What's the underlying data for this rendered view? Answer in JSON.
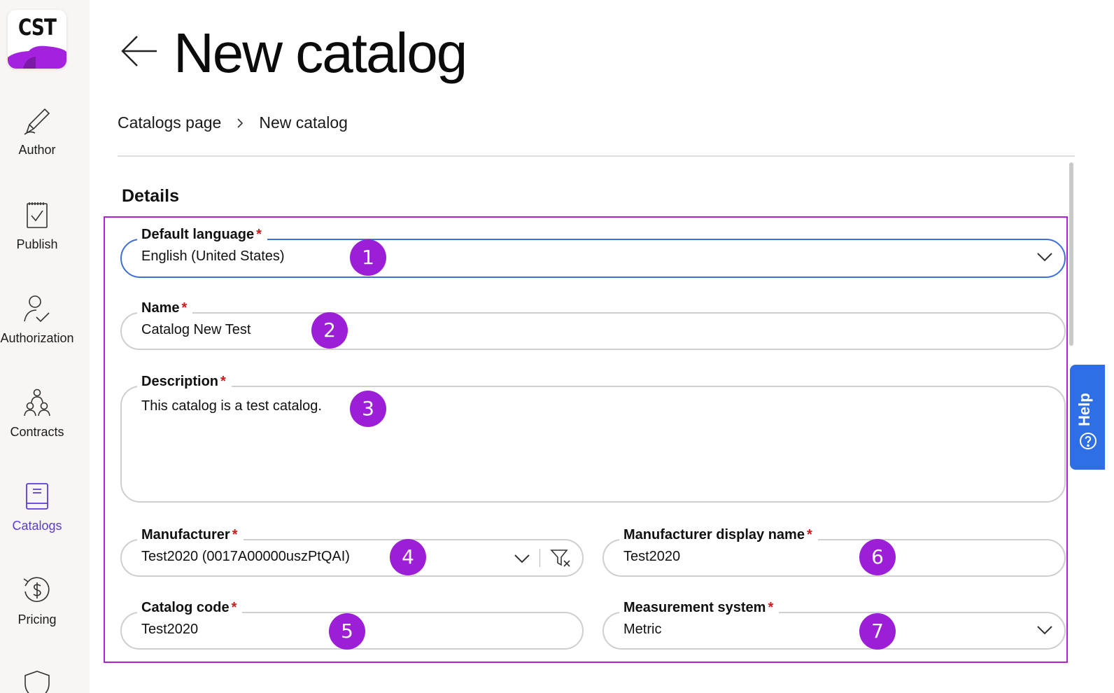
{
  "app": {
    "logo_text": "CST",
    "brand_color": "#a521e0"
  },
  "sidebar": {
    "items": [
      {
        "label": "Author",
        "icon": "pen-icon"
      },
      {
        "label": "Publish",
        "icon": "clipboard-check-icon"
      },
      {
        "label": "Authorization",
        "icon": "user-check-icon"
      },
      {
        "label": "Contracts",
        "icon": "people-group-icon"
      },
      {
        "label": "Catalogs",
        "icon": "book-icon",
        "active": true
      },
      {
        "label": "Pricing",
        "icon": "dollar-refresh-icon"
      }
    ],
    "active_color": "#5b3bd3"
  },
  "header": {
    "title": "New catalog",
    "back_icon": "arrow-left-icon"
  },
  "breadcrumb": {
    "items": [
      "Catalogs page",
      "New catalog"
    ]
  },
  "form": {
    "section_title": "Details",
    "fields": {
      "default_language": {
        "label": "Default language",
        "value": "English (United States)",
        "required": "*"
      },
      "name": {
        "label": "Name",
        "value": "Catalog New Test",
        "required": "*"
      },
      "description": {
        "label": "Description",
        "value": "This catalog is a test catalog.",
        "required": "*"
      },
      "manufacturer": {
        "label": "Manufacturer",
        "value": "Test2020 (0017A00000uszPtQAI)",
        "required": "*"
      },
      "manufacturer_display_name": {
        "label": "Manufacturer display name",
        "value": "Test2020",
        "required": "*"
      },
      "catalog_code": {
        "label": "Catalog code",
        "value": "Test2020",
        "required": "*"
      },
      "measurement_system": {
        "label": "Measurement system",
        "value": "Metric",
        "required": "*"
      }
    }
  },
  "annotations": [
    "1",
    "2",
    "3",
    "4",
    "5",
    "6",
    "7"
  ],
  "help": {
    "label": "Help",
    "color": "#2f6fe6"
  },
  "colors": {
    "highlight": "#b11fd8",
    "badge": "#9c1ed6",
    "required": "#d01a1a",
    "focus": "#3d6fd8"
  }
}
